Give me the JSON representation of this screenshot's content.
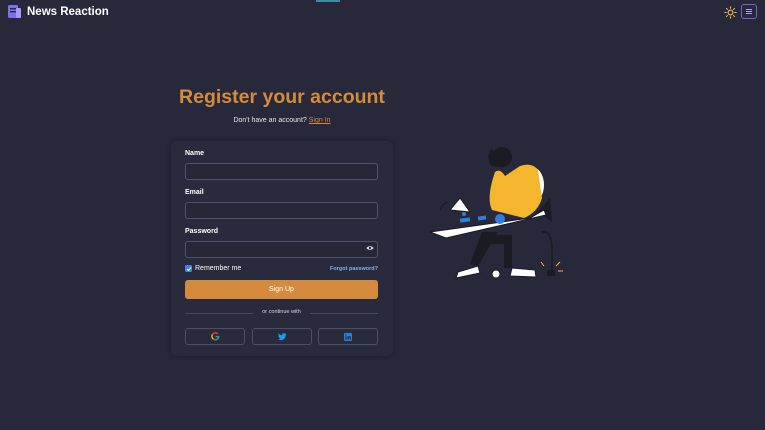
{
  "app": {
    "name": "News Reaction"
  },
  "header": {
    "theme_icon": "sun-icon",
    "menu_icon": "hamburger-menu-icon"
  },
  "register": {
    "title": "Register your account",
    "subtitle_prefix": "Don't have an account?",
    "signin_link": "Sign In",
    "fields": {
      "name": {
        "label": "Name",
        "value": "",
        "placeholder": ""
      },
      "email": {
        "label": "Email",
        "value": "",
        "placeholder": ""
      },
      "password": {
        "label": "Password",
        "value": "",
        "placeholder": ""
      }
    },
    "remember_label": "Remember me",
    "remember_checked": true,
    "forgot_label": "Forgot password?",
    "submit_label": "Sign Up",
    "divider_label": "or continue with",
    "social": [
      {
        "name": "google",
        "icon": "google-icon"
      },
      {
        "name": "twitter",
        "icon": "twitter-icon"
      },
      {
        "name": "linkedin",
        "icon": "linkedin-icon"
      }
    ]
  },
  "colors": {
    "background": "#272839",
    "accent": "#d58b3d",
    "link": "#7db3f5",
    "checkbox": "#3b82f6"
  }
}
